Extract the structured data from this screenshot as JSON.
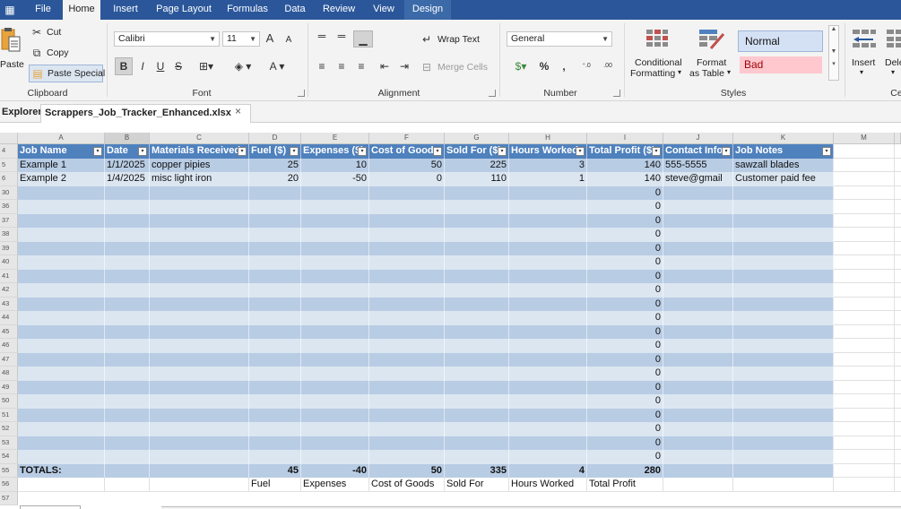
{
  "menu": {
    "app_icon": "▦",
    "tabs": [
      "File",
      "Home",
      "Insert",
      "Page Layout",
      "Formulas",
      "Data",
      "Review",
      "View",
      "Design"
    ],
    "active": "Home"
  },
  "ribbon": {
    "clipboard": {
      "paste": "Paste",
      "cut": "Cut",
      "copy": "Copy",
      "paste_special": "Paste Special",
      "label": "Clipboard"
    },
    "font": {
      "family": "Calibri",
      "size": "11",
      "grow": "A",
      "shrink": "A",
      "bold": "B",
      "italic": "I",
      "underline": "U",
      "strike": "S",
      "font_color": "A",
      "label": "Font"
    },
    "alignment": {
      "wrap_text": "Wrap Text",
      "merge_cells": "Merge Cells",
      "label": "Alignment"
    },
    "number": {
      "format": "General",
      "percent": "%",
      "comma": ",",
      "label": "Number"
    },
    "styles": {
      "conditional": [
        "Conditional",
        "Formatting"
      ],
      "format_table": [
        "Format",
        "as Table"
      ],
      "normal": "Normal",
      "bad": "Bad",
      "label": "Styles"
    },
    "cells": {
      "insert": "Insert",
      "delete": "Dele",
      "label": "Ce"
    }
  },
  "tabs": {
    "explorer": "Explorer",
    "file": "Scrappers_Job_Tracker_Enhanced.xlsx",
    "close": "×"
  },
  "grid": {
    "columns": [
      "A",
      "B",
      "C",
      "D",
      "E",
      "F",
      "G",
      "H",
      "I",
      "J",
      "K",
      "M"
    ],
    "header_row": "4",
    "headers": [
      "Job Name",
      "Date",
      "Materials Received",
      "Fuel ($)",
      "Expenses ($)",
      "Cost of Goods",
      "Sold For ($)",
      "Hours Worked",
      "Total Profit ($)",
      "Contact Info",
      "Job Notes"
    ],
    "rows": [
      {
        "n": "5",
        "cells": [
          "Example 1",
          "1/1/2025",
          "copper pipies",
          "25",
          "10",
          "50",
          "225",
          "3",
          "140",
          "555-5555",
          "sawzall blades"
        ]
      },
      {
        "n": "6",
        "cells": [
          "Example 2",
          "1/4/2025",
          "misc light iron",
          "20",
          "-50",
          "0",
          "110",
          "1",
          "140",
          "steve@gmail",
          "Customer paid fee"
        ]
      }
    ],
    "empty_rows": [
      "30",
      "36",
      "37",
      "38",
      "39",
      "40",
      "41",
      "42",
      "43",
      "44",
      "45",
      "46",
      "47",
      "48",
      "49",
      "50",
      "51",
      "52",
      "53",
      "54"
    ],
    "empty_profit": "0",
    "totals": {
      "n": "55",
      "label": "TOTALS:",
      "fuel": "45",
      "expenses": "-40",
      "cost": "50",
      "sold": "335",
      "hours": "4",
      "profit": "280"
    },
    "labels_row": {
      "n": "56",
      "fuel": "Fuel",
      "expenses": "Expenses",
      "cost": "Cost of Goods",
      "sold": "Sold For",
      "hours": "Hours Worked",
      "profit": "Total Profit"
    },
    "last_row": "57"
  },
  "colors": {
    "menubar": "#2b579a",
    "table_header": "#4f81bd",
    "band_light": "#dce6f1",
    "band_dark": "#b8cce4"
  }
}
